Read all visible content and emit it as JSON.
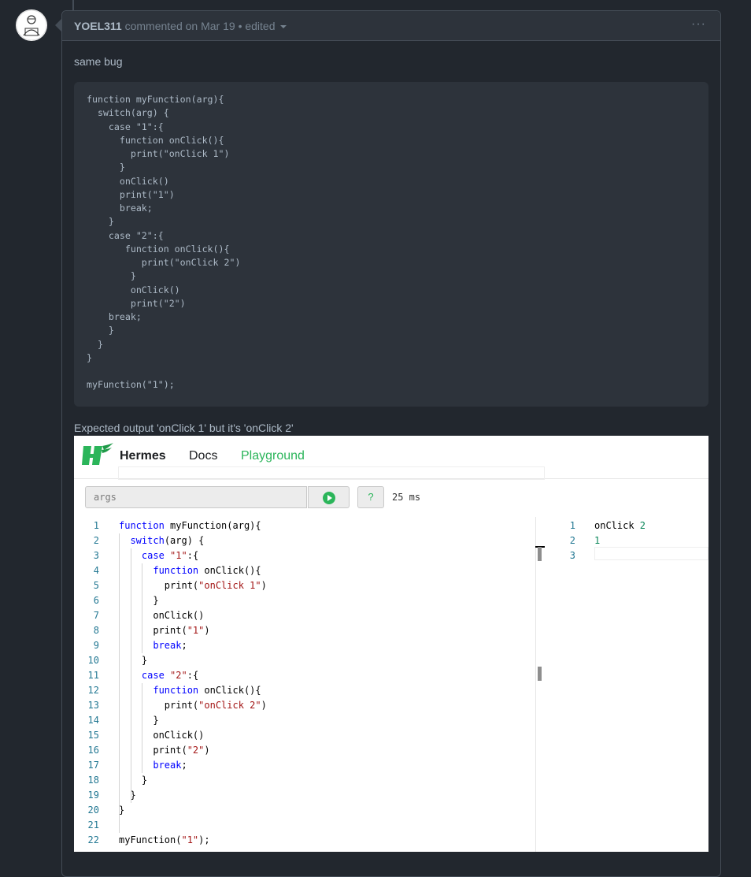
{
  "comment": {
    "author": "YOEL311",
    "action": "commented on Mar 19",
    "separator": "•",
    "edited": "edited",
    "more": "···",
    "body_line1": "same bug",
    "code": "function myFunction(arg){\n  switch(arg) {\n    case \"1\":{\n      function onClick(){\n        print(\"onClick 1\")\n      }\n      onClick()\n      print(\"1\")\n      break;\n    }\n    case \"2\":{\n       function onClick(){\n          print(\"onClick 2\")\n        }\n        onClick()\n        print(\"2\")\n    break;\n    }\n  }\n}\n\nmyFunction(\"1\");",
    "body_line2": "Expected output 'onClick 1' but it's 'onClick 2'"
  },
  "playground": {
    "nav": {
      "brand": "Hermes",
      "docs": "Docs",
      "playground": "Playground"
    },
    "args_placeholder": "args",
    "help_label": "?",
    "timing": "25 ms",
    "editor_lines": [
      {
        "n": "1",
        "html": "<span class=\"kw\">function</span> myFunction(arg){"
      },
      {
        "n": "2",
        "html": "  <span class=\"kw\">switch</span>(arg) {"
      },
      {
        "n": "3",
        "html": "    <span class=\"kw\">case</span> <span class=\"str\">\"1\"</span>:{"
      },
      {
        "n": "4",
        "html": "      <span class=\"kw\">function</span> onClick(){"
      },
      {
        "n": "5",
        "html": "        print(<span class=\"str\">\"onClick 1\"</span>)"
      },
      {
        "n": "6",
        "html": "      }"
      },
      {
        "n": "7",
        "html": "      onClick()"
      },
      {
        "n": "8",
        "html": "      print(<span class=\"str\">\"1\"</span>)"
      },
      {
        "n": "9",
        "html": "      <span class=\"kw\">break</span>;"
      },
      {
        "n": "10",
        "html": "    }"
      },
      {
        "n": "11",
        "html": "    <span class=\"kw\">case</span> <span class=\"str\">\"2\"</span>:{"
      },
      {
        "n": "12",
        "html": "      <span class=\"kw\">function</span> onClick(){"
      },
      {
        "n": "13",
        "html": "        print(<span class=\"str\">\"onClick 2\"</span>)"
      },
      {
        "n": "14",
        "html": "      }"
      },
      {
        "n": "15",
        "html": "      onClick()"
      },
      {
        "n": "16",
        "html": "      print(<span class=\"str\">\"2\"</span>)"
      },
      {
        "n": "17",
        "html": "      <span class=\"kw\">break</span>;"
      },
      {
        "n": "18",
        "html": "    }"
      },
      {
        "n": "19",
        "html": "  }"
      },
      {
        "n": "20",
        "html": "}"
      },
      {
        "n": "21",
        "html": ""
      },
      {
        "n": "22",
        "html": "myFunction(<span class=\"str\">\"1\"</span>);"
      }
    ],
    "output_lines": [
      {
        "n": "1",
        "html": "onClick <span class=\"num\">2</span>"
      },
      {
        "n": "2",
        "html": "<span class=\"num\">1</span>"
      },
      {
        "n": "3",
        "html": ""
      }
    ]
  }
}
